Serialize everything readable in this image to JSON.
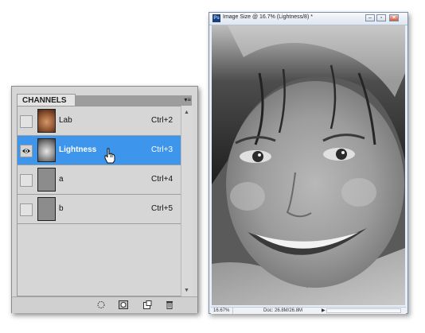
{
  "channels_panel": {
    "tab_label": "CHANNELS",
    "menu_icon": "panel-menu-icon",
    "channels": [
      {
        "name": "Lab",
        "shortcut": "Ctrl+2",
        "visible": false,
        "selected": false
      },
      {
        "name": "Lightness",
        "shortcut": "Ctrl+3",
        "visible": true,
        "selected": true
      },
      {
        "name": "a",
        "shortcut": "Ctrl+4",
        "visible": false,
        "selected": false
      },
      {
        "name": "b",
        "shortcut": "Ctrl+5",
        "visible": false,
        "selected": false
      }
    ],
    "footer_icons": [
      "load-selection-icon",
      "save-selection-icon",
      "new-channel-icon",
      "delete-channel-icon"
    ],
    "selection_color": "#3d96ec"
  },
  "image_window": {
    "title": "Image Size @ 16.7% (Lightness/8) *",
    "app_icon_label": "Ps",
    "status": {
      "zoom": "16.67%",
      "doc": "Doc: 26.8M/26.8M"
    }
  }
}
